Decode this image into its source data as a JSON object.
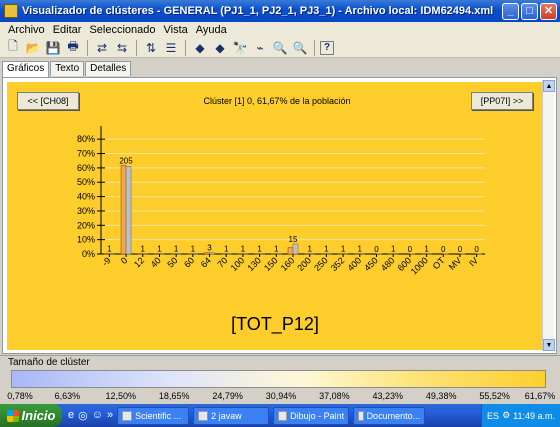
{
  "window": {
    "title": "Visualizador de clústeres - GENERAL (PJ1_1, PJ2_1, PJ3_1) - Archivo local: IDM62494.xml",
    "minimize": "_",
    "maximize": "□",
    "close": "✕"
  },
  "menu": [
    "Archivo",
    "Editar",
    "Seleccionado",
    "Vista",
    "Ayuda"
  ],
  "toolbar": {
    "icons": [
      "new-file-icon",
      "open-folder-icon",
      "save-icon",
      "print-icon",
      "undo-icon",
      "redo-icon",
      "sort-icon",
      "filter-icon",
      "arrow-left-icon",
      "arrow-right-icon",
      "binoculars-icon",
      "chart-icon",
      "zoom-in-icon",
      "zoom-out-icon",
      "help-icon"
    ],
    "glyphs": [
      "🗋",
      "📂",
      "💾",
      "🖶",
      "⇄",
      "⇆",
      "⇅",
      "☰",
      "◆",
      "◆",
      "🔭",
      "⌁",
      "🔍",
      "🔍",
      "?"
    ]
  },
  "tabs": [
    "Gráficos",
    "Texto",
    "Detalles"
  ],
  "chart_panel": {
    "prev_button": "<< [CH08]",
    "next_button": "[PP07I] >>",
    "header": "Clúster [1] 0, 61,67% de la población",
    "variable_label": "[TOT_P12]"
  },
  "chart_data": {
    "type": "bar",
    "categories": [
      "-9",
      "0",
      "12",
      "40",
      "50",
      "60",
      "64",
      "70",
      "100",
      "130",
      "150",
      "160",
      "200",
      "250",
      "352",
      "400",
      "450",
      "480",
      "600",
      "1000",
      "OT",
      "MV",
      "IV"
    ],
    "series": [
      {
        "values": [
          1,
          205,
          1,
          1,
          1,
          1,
          3,
          1,
          1,
          1,
          1,
          15,
          1,
          1,
          1,
          1,
          0,
          1,
          0,
          1,
          0,
          0,
          0
        ]
      }
    ],
    "value_labels": [
      "1",
      "205",
      "1",
      "1",
      "1",
      "1",
      "3",
      "1",
      "1",
      "1",
      "1",
      "15",
      "1",
      "1",
      "1",
      "1",
      "0",
      "1",
      "0",
      "1",
      "0",
      "0",
      "0"
    ],
    "cluster_pct": [
      0.3,
      61.7,
      0.3,
      0.3,
      0.3,
      0.3,
      0.9,
      0.3,
      0.3,
      0.3,
      0.3,
      4.5,
      0.3,
      0.3,
      0.3,
      0.3,
      0,
      0.3,
      0,
      0.3,
      0,
      0,
      0
    ],
    "population_pct": [
      0.5,
      61.0,
      0.4,
      0.4,
      0.4,
      0.4,
      1.0,
      0.4,
      0.4,
      0.4,
      0.4,
      7.0,
      0.4,
      0.4,
      0.4,
      0.4,
      0.1,
      0.4,
      0.1,
      0.4,
      0.1,
      0.1,
      0.1
    ],
    "y_ticks": [
      "0%",
      "10%",
      "20%",
      "30%",
      "40%",
      "50%",
      "60%",
      "70%",
      "80%"
    ],
    "ylim": [
      0,
      85
    ],
    "colors": {
      "cluster": "#f5a54a",
      "population": "#c0c0c0"
    },
    "grid": true
  },
  "legend": {
    "label": "Tamaño de clúster",
    "ticks": [
      "0,78%",
      "6,63%",
      "12,50%",
      "18,65%",
      "24,79%",
      "30,94%",
      "37,08%",
      "43,23%",
      "49,38%",
      "55,52%",
      "61,67%"
    ]
  },
  "taskbar": {
    "start": "Inicio",
    "quick_launch": [
      "e",
      "◎",
      "☺",
      "»"
    ],
    "tasks": [
      "Scientific ...",
      "2 javaw",
      "Dibujo - Paint",
      "Documento..."
    ],
    "tray_lang": "ES",
    "clock": "11:49 a.m."
  }
}
